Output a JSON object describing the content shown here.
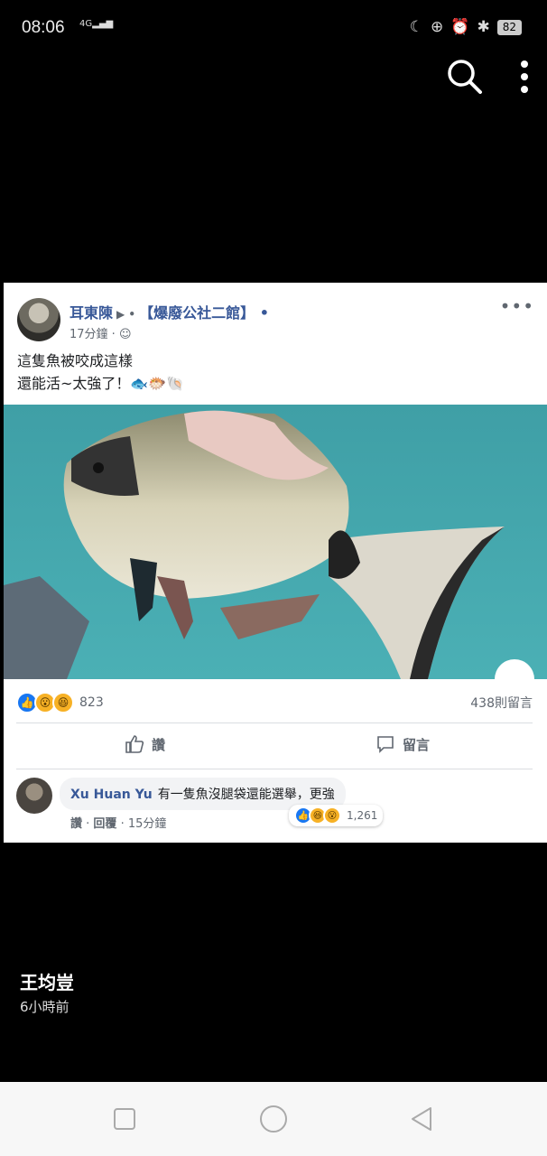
{
  "status": {
    "time": "08:06",
    "signal": "4G",
    "battery": "82"
  },
  "post": {
    "author": "耳東陳",
    "group": "【爆廢公社二館】",
    "time": "17分鐘",
    "text_line1": "這隻魚被咬成這樣",
    "text_line2": "還能活~太強了！",
    "reaction_count": "823",
    "comment_count": "438則留言",
    "like_label": "讚",
    "comment_label": "留言"
  },
  "comment": {
    "name": "Xu Huan Yu",
    "text": "有一隻魚沒腿袋還能選舉，更強",
    "reaction_count": "1,261",
    "like": "讚",
    "reply": "回覆",
    "time": "15分鐘"
  },
  "story": {
    "user": "王均豈",
    "time": "6小時前"
  }
}
